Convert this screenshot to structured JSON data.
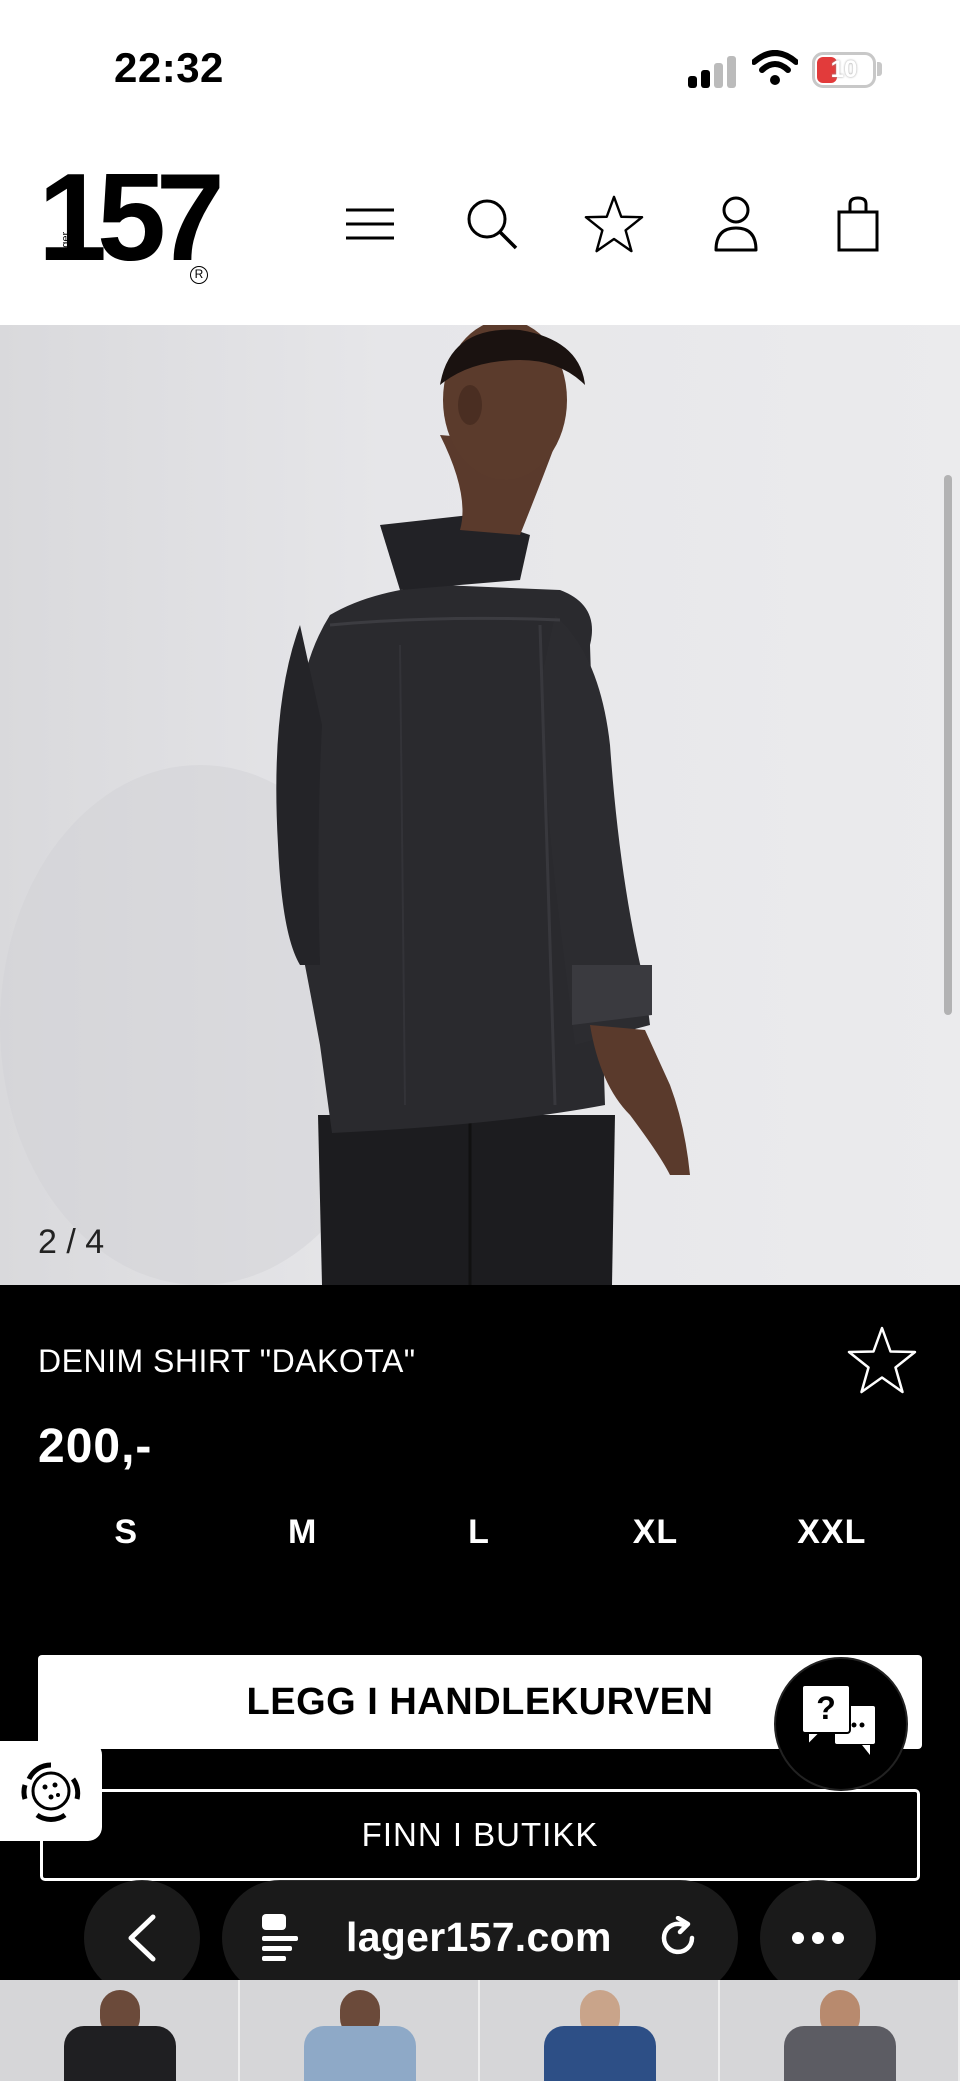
{
  "status_bar": {
    "time": "22:32",
    "battery": "10"
  },
  "header": {
    "logo_number": "157",
    "logo_small_text": "Lager",
    "logo_mark": "R",
    "icons": [
      "menu-icon",
      "search-icon",
      "star-icon",
      "user-icon",
      "shopping-bag-icon"
    ]
  },
  "gallery": {
    "pager": "2 / 4"
  },
  "product": {
    "title": "DENIM SHIRT \"DAKOTA\"",
    "price": "200,-",
    "sizes": [
      "S",
      "M",
      "L",
      "XL",
      "XXL"
    ],
    "add_to_cart_label": "LEGG I HANDLEKURVEN",
    "find_in_store_label": "FINN I BUTIKK"
  },
  "chat": {
    "label": "?"
  },
  "browser": {
    "url": "lager157.com"
  },
  "colors": {
    "panel_bg": "#000000",
    "button_bg": "#ffffff",
    "battery_low": "#e23b3b"
  }
}
